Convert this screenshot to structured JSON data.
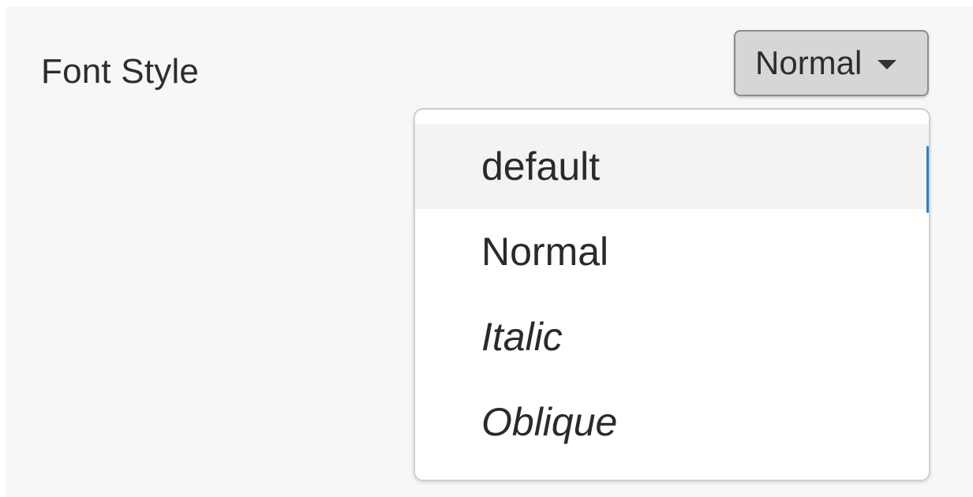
{
  "field": {
    "label": "Font Style"
  },
  "select": {
    "value": "Normal",
    "caret_icon": "caret-down-icon"
  },
  "dropdown": {
    "highlighted_index": 0,
    "options": [
      {
        "label": "default",
        "style": "normal"
      },
      {
        "label": "Normal",
        "style": "normal"
      },
      {
        "label": "Italic",
        "style": "italic"
      },
      {
        "label": "Oblique",
        "style": "italic"
      }
    ]
  },
  "colors": {
    "background": "#f7f7f7",
    "button_fill": "#d6d6d6",
    "highlight": "#f3f3f3",
    "scrollbar_accent": "#2f7fc0"
  }
}
